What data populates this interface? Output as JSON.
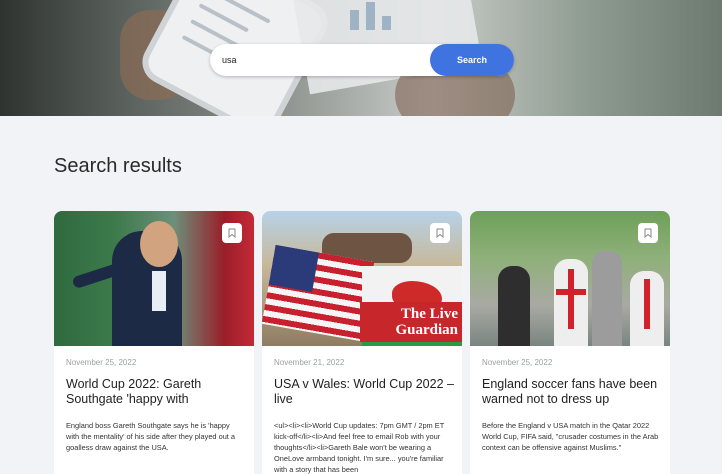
{
  "search": {
    "value": "usa",
    "button_label": "Search"
  },
  "results_heading": "Search results",
  "cards": [
    {
      "date": "November 25, 2022",
      "title": "World Cup 2022: Gareth Southgate 'happy with",
      "excerpt": "England boss Gareth Southgate says he is 'happy with the mentality' of his side after they played out a goalless draw against the USA."
    },
    {
      "date": "November 21, 2022",
      "title": "USA v Wales: World Cup 2022 – live",
      "excerpt": "<ul><li><li>World Cup updates: 7pm GMT / 2pm ET kick-off</li><li>And feel free to email Rob with your thoughts</li><li>Gareth Bale won't be wearing a OneLove armband tonight. I'm sure... you're familiar with a story that has been",
      "image_overlay": "The Live Guardian"
    },
    {
      "date": "November 25, 2022",
      "title": "England soccer fans have been warned not to dress up",
      "excerpt": "Before the England v USA match in the Qatar 2022 World Cup, FIFA said, \"crusader costumes in the Arab context can be offensive against Muslims.\""
    }
  ],
  "colors": {
    "accent": "#3e73e0",
    "background": "#f1f3f6"
  },
  "icons": {
    "bookmark": "bookmark-icon"
  }
}
